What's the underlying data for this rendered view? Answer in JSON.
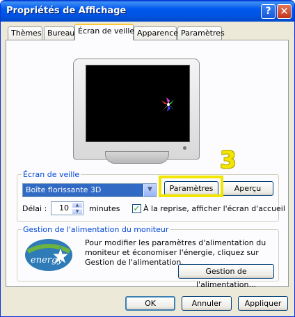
{
  "window": {
    "title": "Propriétés de Affichage"
  },
  "titlebar_buttons": {
    "help": "?",
    "close": "✕"
  },
  "tabs": [
    {
      "label": "Thèmes"
    },
    {
      "label": "Bureau"
    },
    {
      "label": "Écran de veille",
      "active": true
    },
    {
      "label": "Apparence"
    },
    {
      "label": "Paramètres"
    }
  ],
  "screensaver": {
    "group_title": "Écran de veille",
    "selected": "Boîte florissante 3D",
    "settings_button": "Paramètres",
    "preview_button": "Aperçu",
    "delay_label": "Délai :",
    "delay_value": "10",
    "minutes_label": "minutes",
    "welcome_checkbox_label": "À la reprise, afficher l'écran d'accueil",
    "welcome_checked": true
  },
  "power": {
    "group_title": "Gestion de l'alimentation du moniteur",
    "description": "Pour modifier les paramètres d'alimentation du moniteur et économiser l'énergie, cliquez sur Gestion de l'alimentation.",
    "button": "Gestion de l'alimentation...",
    "logo_text": "energy"
  },
  "callout": {
    "number": "3",
    "color": "#f2e600"
  },
  "footer": {
    "ok": "OK",
    "cancel": "Annuler",
    "apply": "Appliquer"
  },
  "colors": {
    "titlebar": "#0054e3",
    "accent": "#0046d5",
    "selection": "#316ac5"
  }
}
